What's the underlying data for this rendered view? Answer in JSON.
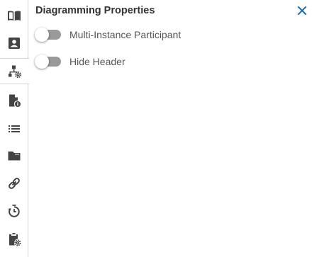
{
  "panel": {
    "title": "Diagramming Properties"
  },
  "toggles": [
    {
      "label": "Multi-Instance Participant",
      "checked": false
    },
    {
      "label": "Hide Header",
      "checked": false
    }
  ],
  "sidebar": {
    "items": [
      {
        "icon": "book-icon",
        "active": false
      },
      {
        "icon": "contact-card-icon",
        "active": false
      },
      {
        "icon": "diagram-settings-icon",
        "active": true
      },
      {
        "icon": "document-info-icon",
        "active": false
      },
      {
        "icon": "list-icon",
        "active": false
      },
      {
        "icon": "folder-icon",
        "active": false
      },
      {
        "icon": "link-icon",
        "active": false
      },
      {
        "icon": "timer-refresh-icon",
        "active": false
      },
      {
        "icon": "clipboard-settings-icon",
        "active": false
      }
    ]
  },
  "colors": {
    "icon": "#444444",
    "close": "#1a6bb8",
    "toggle_off_track": "#9a9a9a",
    "title": "#333333",
    "label": "#555555"
  }
}
